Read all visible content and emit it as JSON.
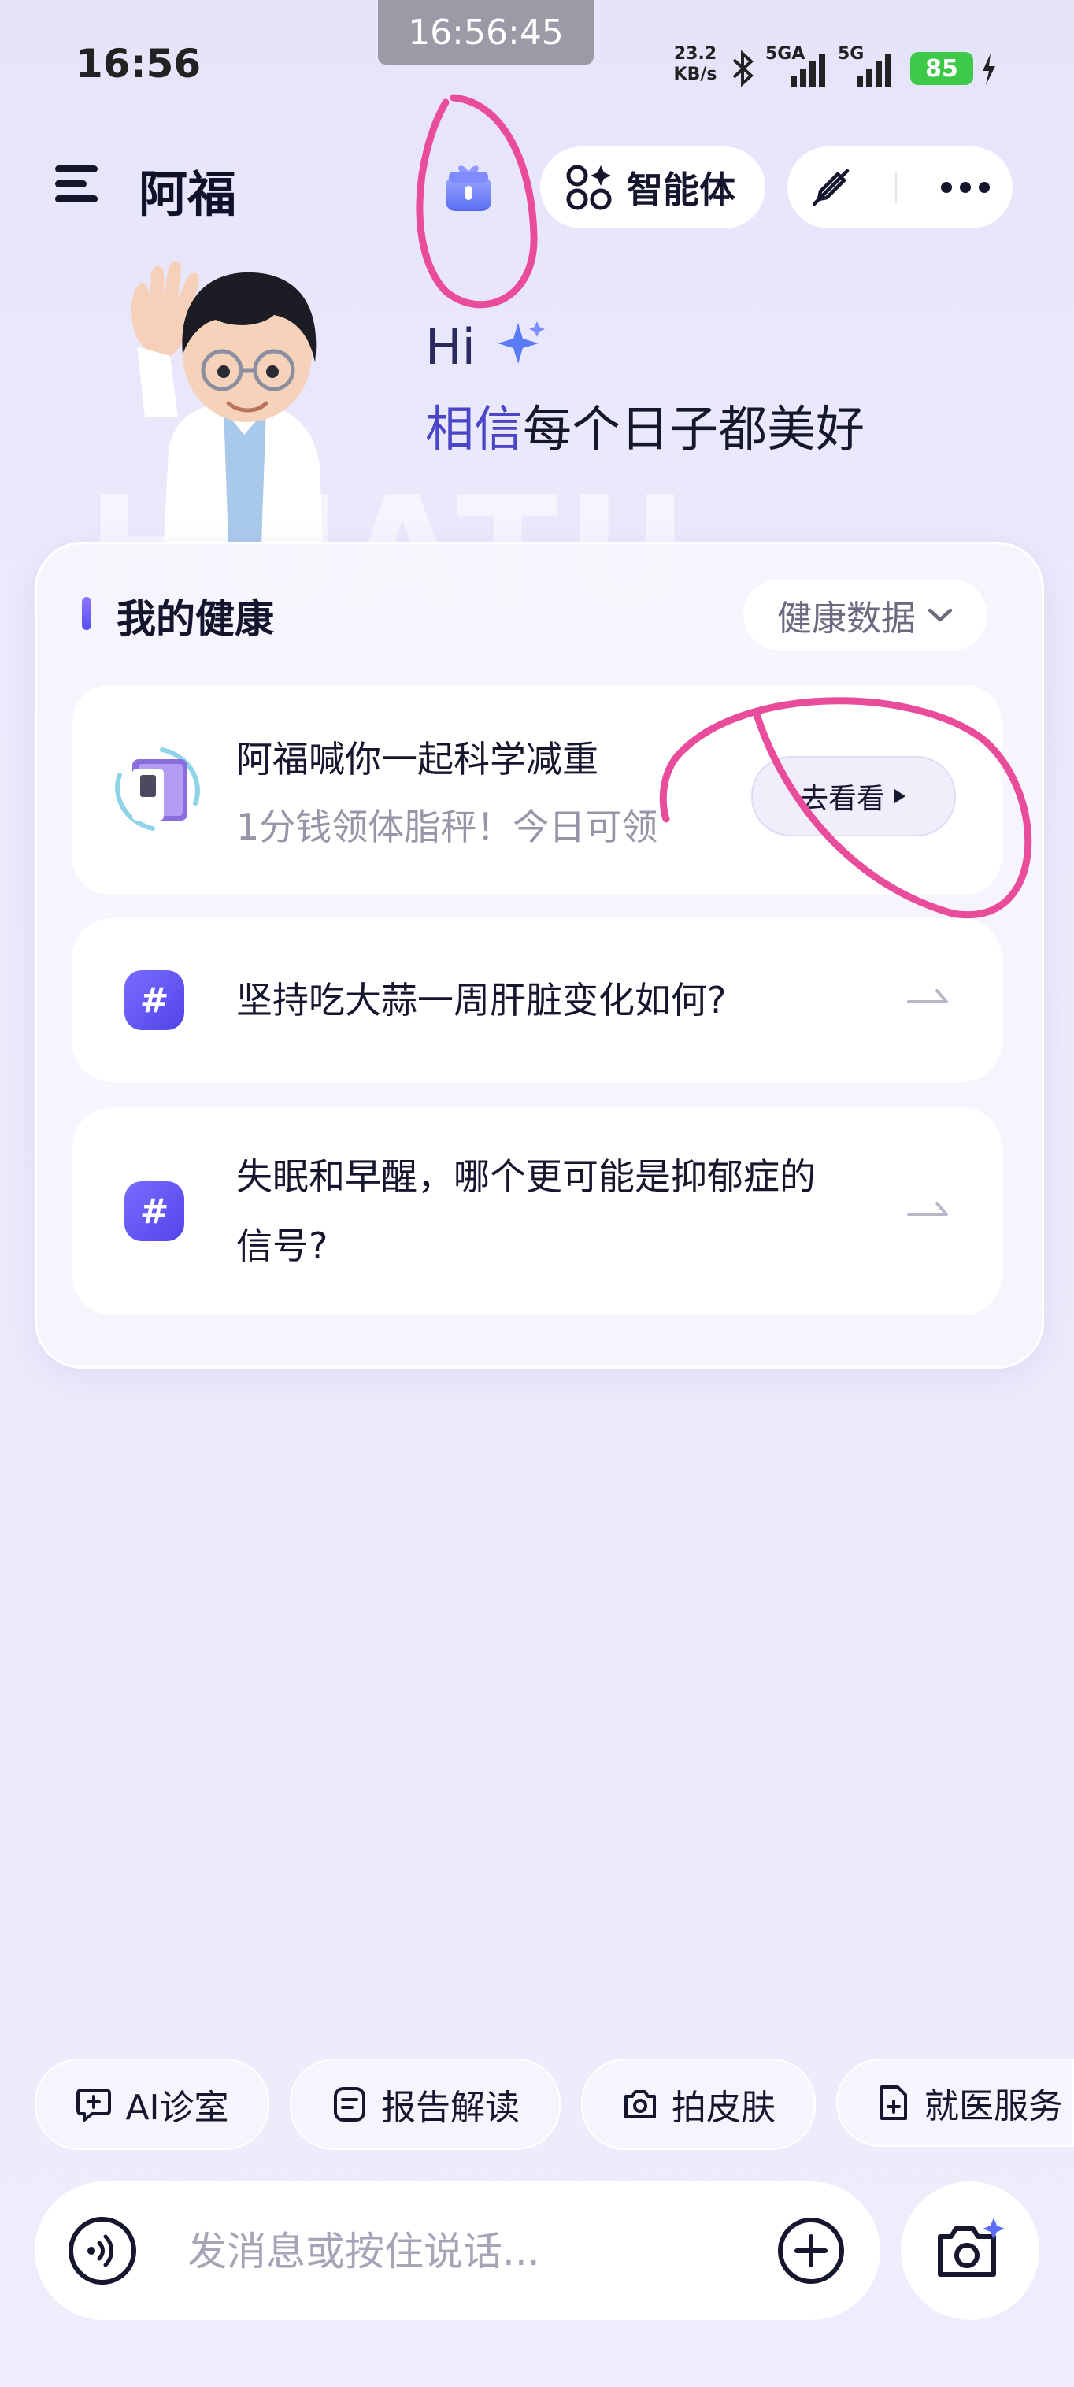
{
  "status_bar": {
    "time": "16:56",
    "screenshot_clock": "16:56:45",
    "net_speed_value": "23.2",
    "net_speed_unit": "KB/s",
    "signal1_label": "5GA",
    "signal2_label": "5G",
    "battery": "85"
  },
  "header": {
    "title": "阿福",
    "agents_label": "智能体"
  },
  "greeting": {
    "hi": "Hi",
    "message_accent": "相信",
    "message_rest": "每个日子都美好"
  },
  "health_card": {
    "title": "我的健康",
    "data_button": "健康数据",
    "promo": {
      "title": "阿福喊你一起科学减重",
      "subtitle": "1分钱领体脂秤！今日可领",
      "button": "去看看"
    },
    "questions": [
      {
        "tag": "#",
        "line1": "坚持吃大蒜一周肝脏变化如何?"
      },
      {
        "tag": "#",
        "line1": "失眠和早醒，哪个更可能是抑郁症的",
        "line2": "信号?"
      }
    ]
  },
  "chips": [
    {
      "label": "AI诊室",
      "icon": "chat-plus-icon"
    },
    {
      "label": "报告解读",
      "icon": "document-icon"
    },
    {
      "label": "拍皮肤",
      "icon": "camera-icon"
    },
    {
      "label": "就医服务",
      "icon": "document-plus-icon"
    }
  ],
  "input": {
    "placeholder": "发消息或按住说话..."
  },
  "colors": {
    "accent": "#5b4ef0",
    "annotation": "#ea4c9c",
    "battery": "#3ec948"
  }
}
